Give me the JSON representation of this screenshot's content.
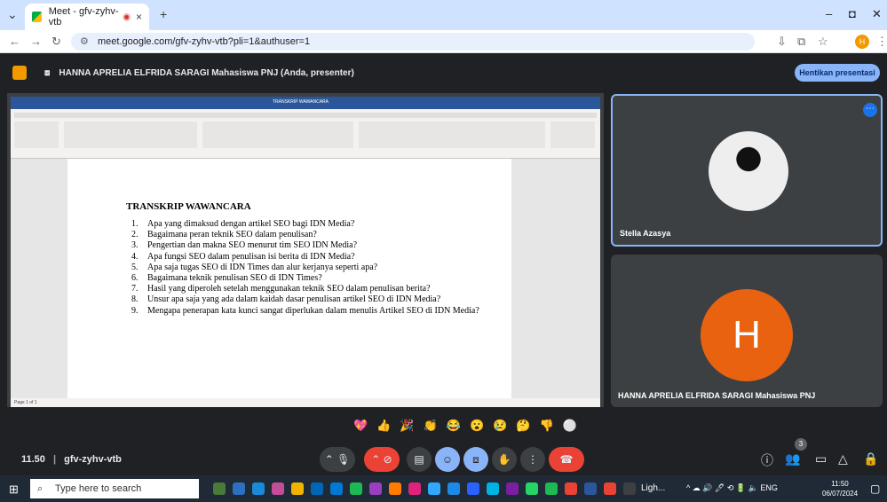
{
  "browser": {
    "tab_title": "Meet - gfv-zyhv-vtb",
    "url": "meet.google.com/gfv-zyhv-vtb?pli=1&authuser=1",
    "profile_initial": "H"
  },
  "meet": {
    "presenter_text": "HANNA APRELIA ELFRIDA SARAGI Mahasiswa PNJ (Anda, presenter)",
    "stop_button": "Hentikan presentasi",
    "meeting_time": "11.50",
    "meeting_code": "gfv-zyhv-vtb",
    "participants_count": "3",
    "participants": [
      {
        "name": "Stella Azasya"
      },
      {
        "name": "HANNA APRELIA ELFRIDA SARAGI Mahasiswa PNJ",
        "initial": "H"
      }
    ],
    "reactions": [
      "💖",
      "👍",
      "🎉",
      "👏",
      "😂",
      "😮",
      "😢",
      "🤔",
      "👎",
      "⚪"
    ]
  },
  "document": {
    "window_title": "TRANSKRIP WAWANCARA",
    "heading": "TRANSKRIP WAWANCARA",
    "questions": [
      "Apa yang dimaksud dengan artikel SEO bagi IDN Media?",
      "Bagaimana peran teknik SEO dalam penulisan?",
      "Pengertian dan makna SEO menurut tim SEO IDN Media?",
      "Apa fungsi SEO dalam penulisan isi berita di IDN Media?",
      "Apa saja tugas SEO di IDN Times dan alur kerjanya seperti apa?",
      "Bagaimana teknik penulisan SEO di IDN Times?",
      "Hasil yang diperoleh setelah menggunakan teknik SEO dalam penulisan berita?",
      "Unsur apa saja yang ada dalam kaidah dasar penulisan artikel SEO di IDN Media?",
      "Mengapa penerapan kata kunci sangat diperlukan dalam menulis Artikel SEO di IDN Media?"
    ],
    "page_status": "Page 1 of 1"
  },
  "taskbar": {
    "search_placeholder": "Type here to search",
    "active_app": "Ligh...",
    "language": "ENG",
    "time": "11:50",
    "date": "06/07/2024"
  }
}
